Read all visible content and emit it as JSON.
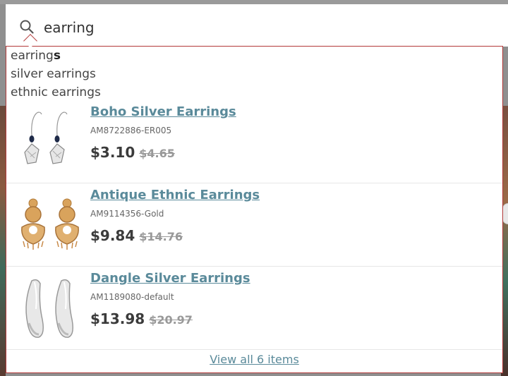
{
  "search": {
    "query": "earring",
    "icon": "search-icon"
  },
  "suggestions": [
    {
      "prefix": "earring",
      "bold": "s"
    },
    {
      "prefix": "silver earrings",
      "bold": ""
    },
    {
      "prefix": "ethnic earrings",
      "bold": ""
    }
  ],
  "products": [
    {
      "name": "Boho Silver Earrings",
      "sku": "AM8722886-ER005",
      "price": "$3.10",
      "old_price": "$4.65"
    },
    {
      "name": "Antique Ethnic Earrings",
      "sku": "AM9114356-Gold",
      "price": "$9.84",
      "old_price": "$14.76"
    },
    {
      "name": "Dangle Silver Earrings",
      "sku": "AM1189080-default",
      "price": "$13.98",
      "old_price": "$20.97"
    }
  ],
  "footer": {
    "view_all_label": "View all 6 items"
  },
  "colors": {
    "accent": "#5a8a9a",
    "border": "#b33a3a",
    "price": "#3b3b3b"
  }
}
